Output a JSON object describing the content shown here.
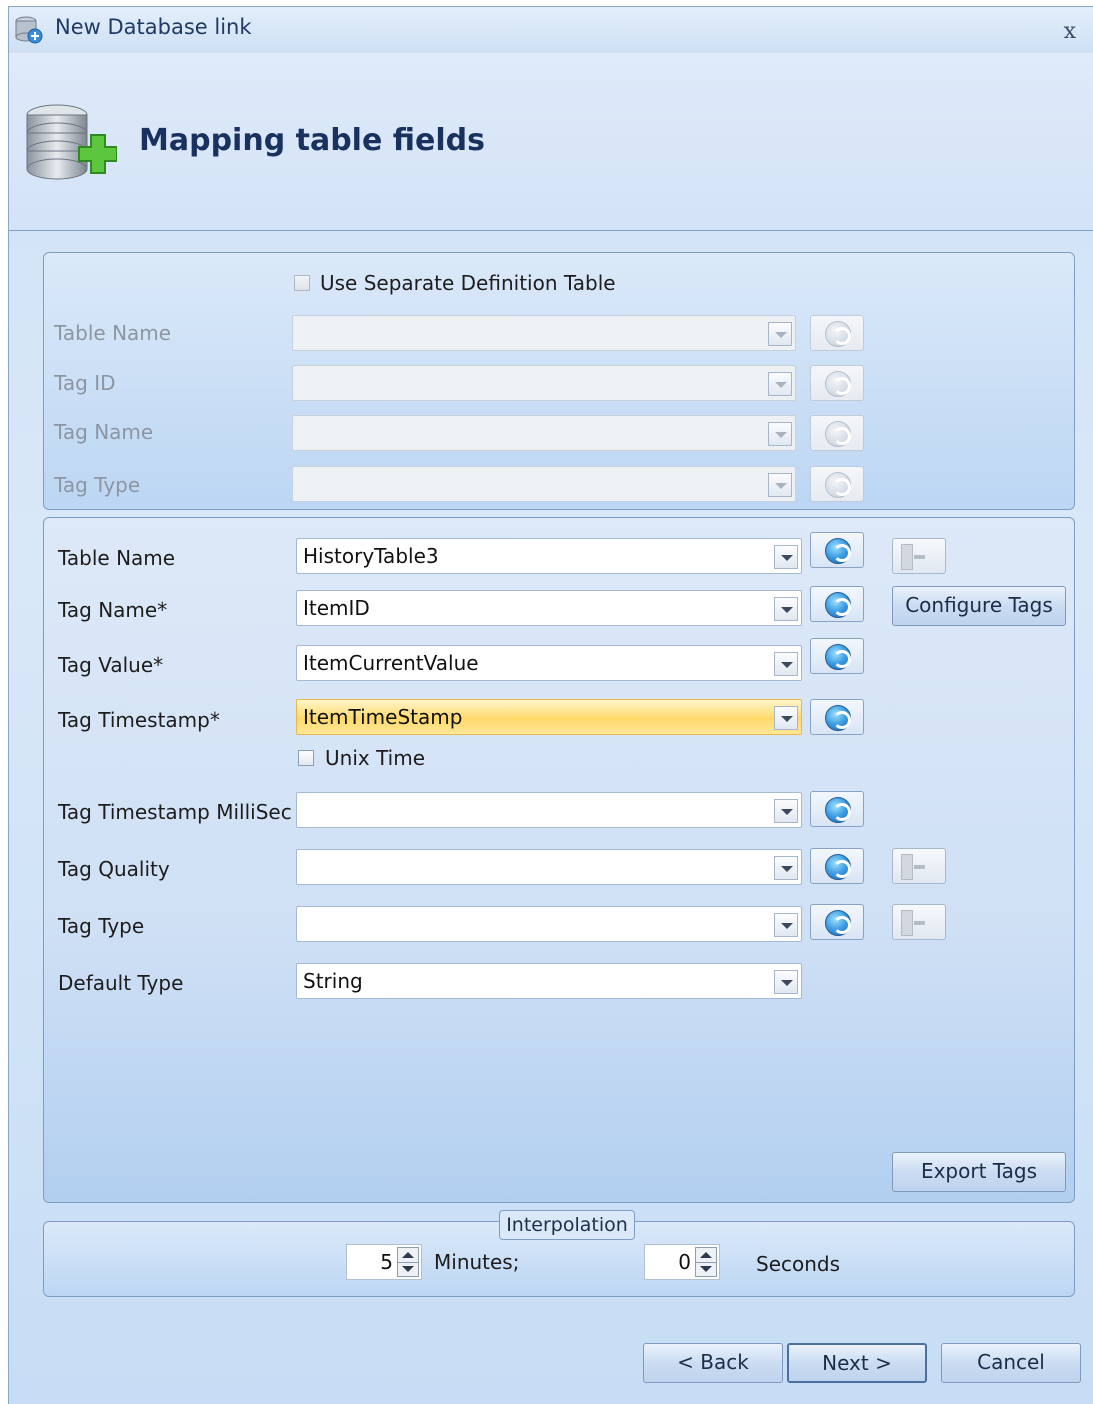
{
  "window": {
    "title": "New Database link",
    "close_symbol": "x"
  },
  "header": {
    "heading": "Mapping table fields"
  },
  "definition": {
    "use_separate_label": "Use Separate Definition Table",
    "use_separate_checked": false,
    "fields": [
      {
        "label": "Table Name",
        "value": ""
      },
      {
        "label": "Tag ID",
        "value": ""
      },
      {
        "label": "Tag Name",
        "value": ""
      },
      {
        "label": "Tag Type",
        "value": ""
      }
    ]
  },
  "mapping": {
    "fields": [
      {
        "label": "Table Name",
        "value": "HistoryTable3"
      },
      {
        "label": "Tag Name*",
        "value": "ItemID"
      },
      {
        "label": "Tag Value*",
        "value": "ItemCurrentValue"
      },
      {
        "label": "Tag Timestamp*",
        "value": "ItemTimeStamp"
      },
      {
        "label": "Tag Timestamp MilliSec",
        "value": ""
      },
      {
        "label": "Tag Quality",
        "value": ""
      },
      {
        "label": "Tag Type",
        "value": ""
      },
      {
        "label": "Default Type",
        "value": "String"
      }
    ],
    "unix_time_label": "Unix Time",
    "unix_time_checked": false,
    "configure_tags_label": "Configure Tags",
    "export_tags_label": "Export Tags"
  },
  "interpolation": {
    "legend": "Interpolation",
    "minutes_value": "5",
    "minutes_label": "Minutes;",
    "seconds_value": "0",
    "seconds_label": "Seconds"
  },
  "footer": {
    "back_label": "< Back",
    "next_label": "Next >",
    "cancel_label": "Cancel"
  },
  "colors": {
    "highlight": "#ffd96b",
    "heading": "#18315e",
    "panel": "#cfe2f6"
  }
}
